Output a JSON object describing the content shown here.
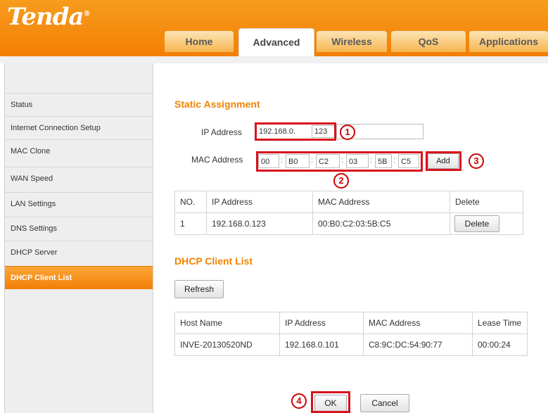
{
  "header": {
    "logo": "Tenda",
    "logo_mark": "®",
    "tabs": [
      {
        "label": "Home"
      },
      {
        "label": "Advanced"
      },
      {
        "label": "Wireless"
      },
      {
        "label": "QoS"
      },
      {
        "label": "Applications"
      }
    ],
    "active_tab": "Advanced"
  },
  "sidebar": {
    "items": [
      {
        "label": "Status"
      },
      {
        "label": "Internet Connection Setup"
      },
      {
        "label": "MAC Clone"
      },
      {
        "label": "WAN Speed"
      },
      {
        "label": "LAN Settings"
      },
      {
        "label": "DNS Settings"
      },
      {
        "label": "DHCP Server"
      },
      {
        "label": "DHCP Client List"
      }
    ],
    "active_item": "DHCP Client List"
  },
  "static_assignment": {
    "title": "Static Assignment",
    "ip_label": "IP Address",
    "ip_prefix": "192.168.0.",
    "ip_last_octet": "123",
    "mac_label": "MAC Address",
    "mac_octets": [
      "00",
      "B0",
      "C2",
      "03",
      "5B",
      "C5"
    ],
    "add_label": "Add",
    "table": {
      "headers": [
        "NO.",
        "IP Address",
        "MAC Address",
        "Delete"
      ],
      "rows": [
        {
          "no": "1",
          "ip": "192.168.0.123",
          "mac": "00:B0:C2:03:5B:C5",
          "delete_label": "Delete"
        }
      ]
    }
  },
  "dhcp_client_list": {
    "title": "DHCP Client List",
    "refresh_label": "Refresh",
    "table": {
      "headers": [
        "Host Name",
        "IP Address",
        "MAC Address",
        "Lease Time"
      ],
      "rows": [
        {
          "host": "INVE-20130520ND",
          "ip": "192.168.0.101",
          "mac": "C8:9C:DC:54:90:77",
          "lease": "00:00:24"
        }
      ]
    }
  },
  "footer": {
    "ok_label": "OK",
    "cancel_label": "Cancel"
  },
  "annotations": [
    "1",
    "2",
    "3",
    "4"
  ],
  "colors": {
    "brand_orange": "#f37f05",
    "section_title": "#f08300",
    "highlight_red": "#d8121c"
  }
}
